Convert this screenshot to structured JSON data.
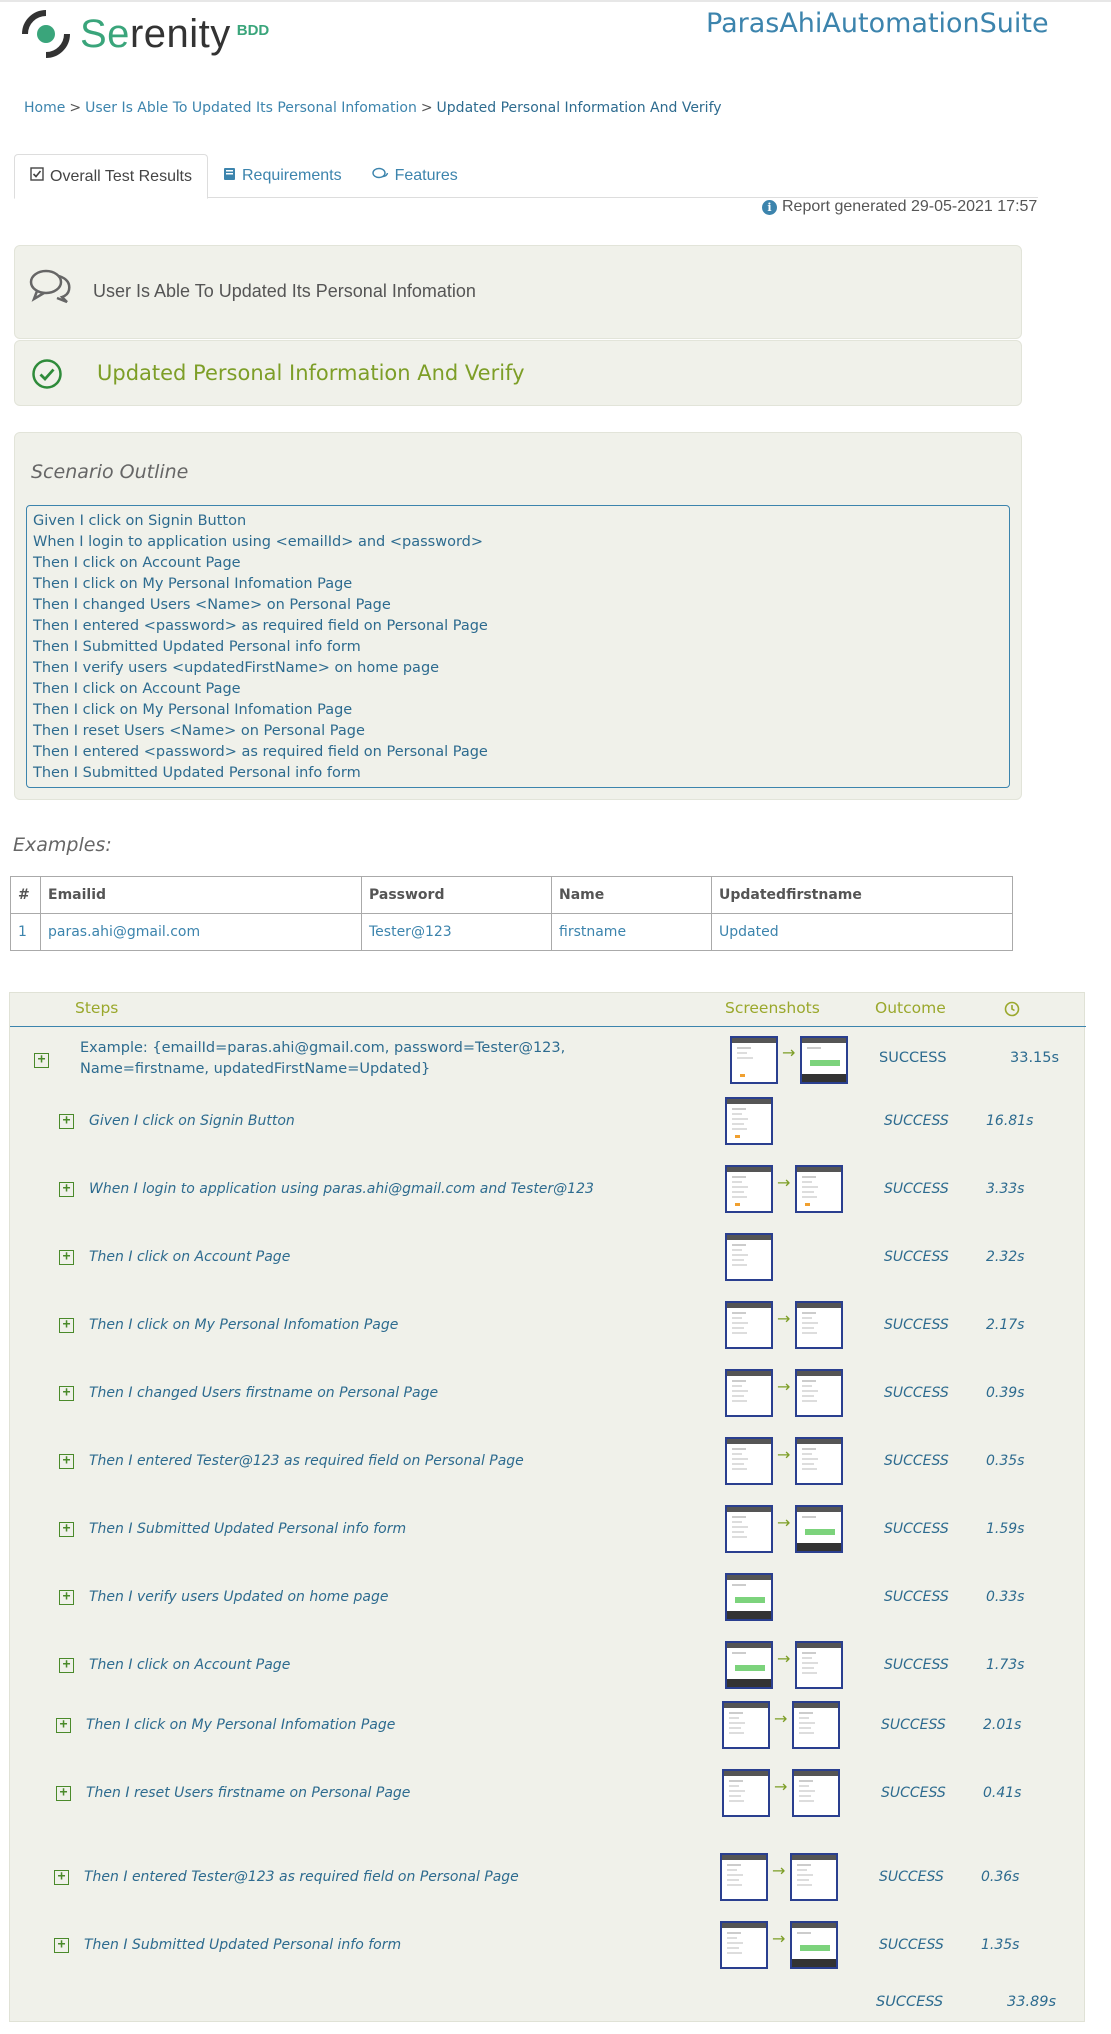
{
  "header": {
    "logo_prefix": "Se",
    "logo_rest": "renity",
    "logo_suffix": "BDD",
    "project_title": "ParasAhiAutomationSuite"
  },
  "breadcrumb": {
    "home": "Home",
    "sep": ">",
    "requirement": "User Is Able To Updated Its Personal Infomation",
    "scenario": "Updated Personal Information And Verify"
  },
  "tabs": [
    {
      "label": "Overall Test Results",
      "icon": "checkbox-icon"
    },
    {
      "label": "Requirements",
      "icon": "book-icon"
    },
    {
      "label": "Features",
      "icon": "comments-icon"
    }
  ],
  "report": {
    "generated": "Report generated 29-05-2021 17:57"
  },
  "requirement_title": "User Is Able To Updated Its Personal Infomation",
  "scenario_title": "Updated Personal Information And Verify",
  "outline": {
    "heading": "Scenario Outline",
    "lines": [
      "Given I click on Signin Button",
      "When I login to application using <emailId> and <password>",
      "Then I click on Account Page",
      "Then I click on My Personal Infomation Page",
      "Then I changed Users <Name> on Personal Page",
      "Then I entered <password> as required field on Personal Page",
      "Then I Submitted Updated Personal info form",
      "Then I verify users <updatedFirstName> on home page",
      "Then I click on Account Page",
      "Then I click on My Personal Infomation Page",
      "Then I reset Users <Name> on Personal Page",
      "Then I entered <password> as required field on Personal Page",
      "Then I Submitted Updated Personal info form"
    ]
  },
  "examples": {
    "label": "Examples:",
    "headers": [
      "#",
      "Emailid",
      "Password",
      "Name",
      "Updatedfirstname"
    ],
    "rows": [
      [
        "1",
        "paras.ahi@gmail.com",
        "Tester@123",
        "firstname",
        "Updated"
      ]
    ]
  },
  "steps_table": {
    "headers": {
      "steps": "Steps",
      "screenshots": "Screenshots",
      "outcome": "Outcome",
      "duration_icon": "clock-icon"
    },
    "example_row": {
      "line1": "Example: {emailId=paras.ahi@gmail.com, password=Tester@123,",
      "line2": "Name=firstname, updatedFirstName=Updated}",
      "outcome": "SUCCESS",
      "duration": "33.15s"
    },
    "steps": [
      {
        "text": "Given I click on Signin Button",
        "outcome": "SUCCESS",
        "duration": "16.81s",
        "shots": 1
      },
      {
        "text": "When I login to application using paras.ahi@gmail.com and Tester@123",
        "outcome": "SUCCESS",
        "duration": "3.33s",
        "shots": 2
      },
      {
        "text": "Then I click on Account Page",
        "outcome": "SUCCESS",
        "duration": "2.32s",
        "shots": 1
      },
      {
        "text": "Then I click on My Personal Infomation Page",
        "outcome": "SUCCESS",
        "duration": "2.17s",
        "shots": 2
      },
      {
        "text": "Then I changed Users firstname on Personal Page",
        "outcome": "SUCCESS",
        "duration": "0.39s",
        "shots": 2
      },
      {
        "text": "Then I entered Tester@123 as required field on Personal Page",
        "outcome": "SUCCESS",
        "duration": "0.35s",
        "shots": 2
      },
      {
        "text": "Then I Submitted Updated Personal info form",
        "outcome": "SUCCESS",
        "duration": "1.59s",
        "shots": 2
      },
      {
        "text": "Then I verify users Updated on home page",
        "outcome": "SUCCESS",
        "duration": "0.33s",
        "shots": 1
      },
      {
        "text": "Then I click on Account Page",
        "outcome": "SUCCESS",
        "duration": "1.73s",
        "shots": 2
      },
      {
        "text": "Then I click on My Personal Infomation Page",
        "outcome": "SUCCESS",
        "duration": "2.01s",
        "shots": 2
      },
      {
        "text": "Then I reset Users firstname on Personal Page",
        "outcome": "SUCCESS",
        "duration": "0.41s",
        "shots": 2
      },
      {
        "text": "Then I entered Tester@123 as required field on Personal Page",
        "outcome": "SUCCESS",
        "duration": "0.36s",
        "shots": 2
      },
      {
        "text": "Then I Submitted Updated Personal info form",
        "outcome": "SUCCESS",
        "duration": "1.35s",
        "shots": 2
      }
    ],
    "total": {
      "outcome": "SUCCESS",
      "duration": "33.89s"
    }
  },
  "colors": {
    "accent": "#3c84ad",
    "success_green": "#7d9e27",
    "logo_green": "#3aa57b",
    "panel_bg": "#f0f1ea"
  }
}
